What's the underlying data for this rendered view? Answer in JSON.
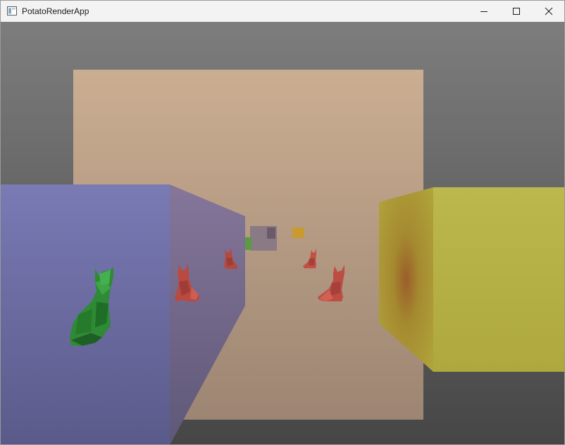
{
  "window": {
    "title": "PotatoRenderApp",
    "icons": {
      "app": "app-window-icon",
      "minimize": "minimize-icon",
      "maximize": "maximize-icon",
      "close": "close-icon"
    }
  },
  "scene": {
    "description_objects": {
      "cats": [
        "green-cat",
        "red-cat",
        "red-cat",
        "red-cat",
        "red-cat"
      ],
      "boxes": [
        "blue-box",
        "yellow-box"
      ]
    },
    "colors": {
      "background_top": "#7d7d7d",
      "background_bottom": "#4a4a4a",
      "back_wall": "#c9ad90",
      "blue_box_front": "#7878b0",
      "blue_box_side": "#7e7094",
      "yellow_box_front": "#b8b448",
      "yellow_box_side": "#a49a30",
      "green_cat": "#2e8a35",
      "red_cat": "#b94a40"
    }
  }
}
